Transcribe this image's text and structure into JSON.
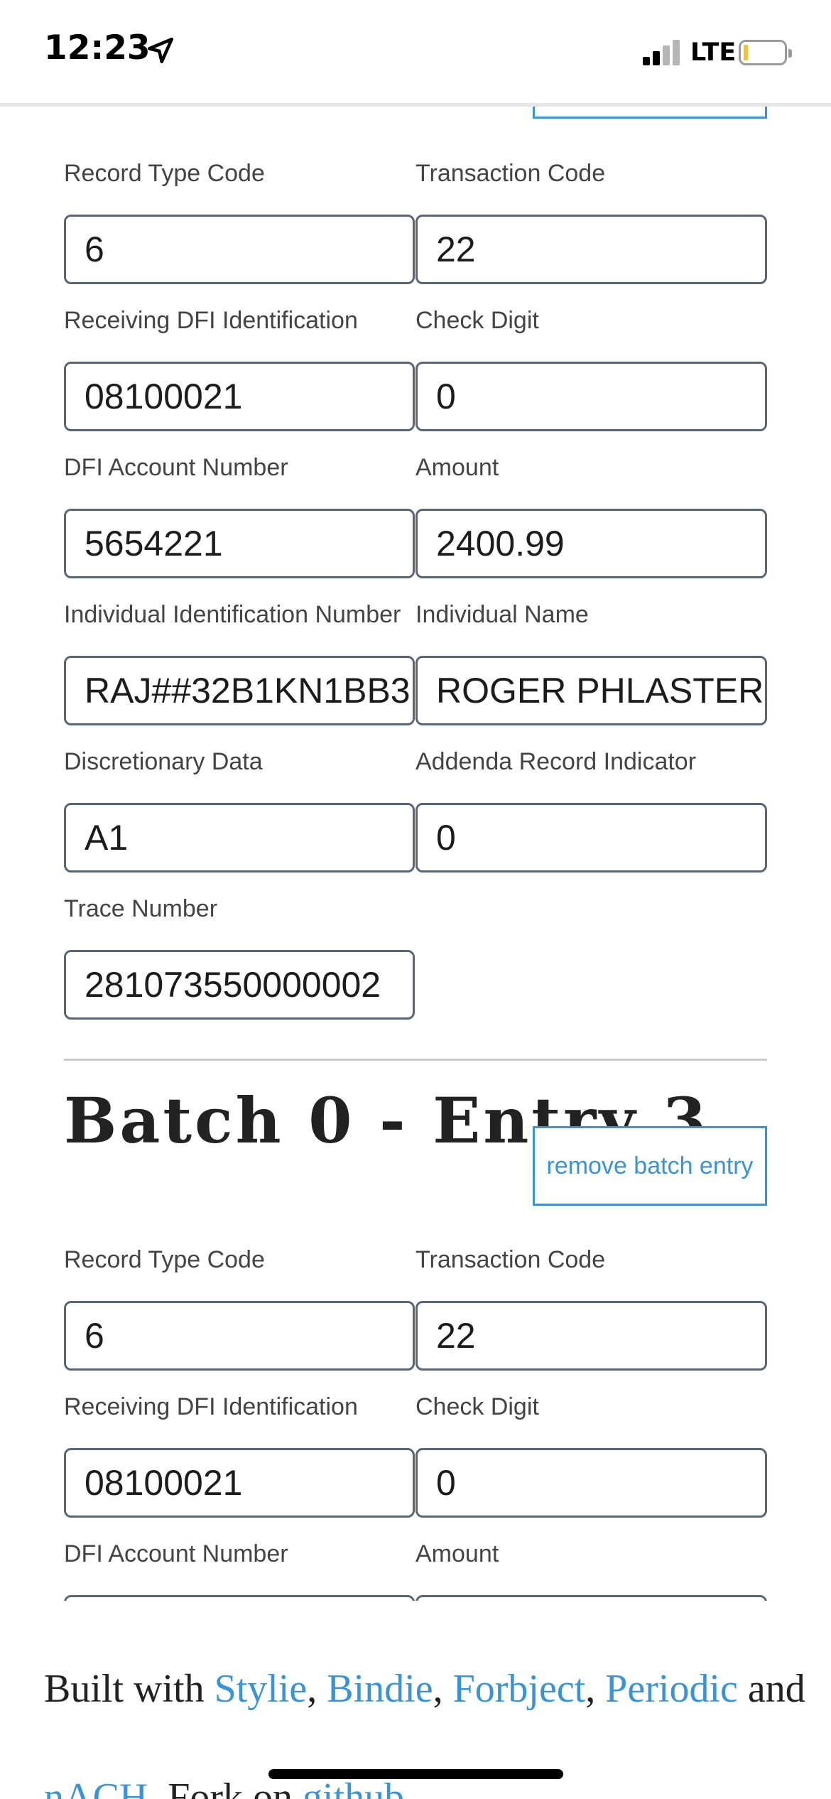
{
  "status_bar": {
    "time": "12:23",
    "network": "LTE",
    "icons": [
      "location-arrow-icon",
      "signal-icon",
      "battery-icon"
    ]
  },
  "entry_2": {
    "record_type_code": {
      "label": "Record Type Code",
      "value": "6"
    },
    "transaction_code": {
      "label": "Transaction Code",
      "value": "22"
    },
    "receiving_dfi": {
      "label": "Receiving DFI Identification",
      "value": "08100021"
    },
    "check_digit": {
      "label": "Check Digit",
      "value": "0"
    },
    "dfi_account": {
      "label": "DFI Account Number",
      "value": "5654221"
    },
    "amount": {
      "label": "Amount",
      "value": "2400.99"
    },
    "individual_id": {
      "label": "Individual Identification Number",
      "value": "RAJ##32B1KN1BB3"
    },
    "individual_name": {
      "label": "Individual Name",
      "value": "ROGER PHLASTER"
    },
    "discretionary_data": {
      "label": "Discretionary Data",
      "value": "A1"
    },
    "addenda_indicator": {
      "label": "Addenda Record Indicator",
      "value": "0"
    },
    "trace_number": {
      "label": "Trace Number",
      "value": "281073550000002"
    }
  },
  "entry_3": {
    "heading": "Batch 0 - Entry 3",
    "remove_label": "remove batch entry",
    "record_type_code": {
      "label": "Record Type Code",
      "value": "6"
    },
    "transaction_code": {
      "label": "Transaction Code",
      "value": "22"
    },
    "receiving_dfi": {
      "label": "Receiving DFI Identification",
      "value": "08100021"
    },
    "check_digit": {
      "label": "Check Digit",
      "value": "0"
    },
    "dfi_account": {
      "label": "DFI Account Number"
    },
    "amount": {
      "label": "Amount"
    }
  },
  "footer": {
    "built_with": "Built with ",
    "sep": ", ",
    "links": [
      "Stylie",
      "Bindie",
      "Forbject",
      "Periodic"
    ],
    "and": " and",
    "nach": "nACH",
    "fork": ". Fork on ",
    "github": "github"
  },
  "colors": {
    "link": "#3a93d6",
    "input_border": "#5a6675",
    "divider": "#cccccc"
  }
}
